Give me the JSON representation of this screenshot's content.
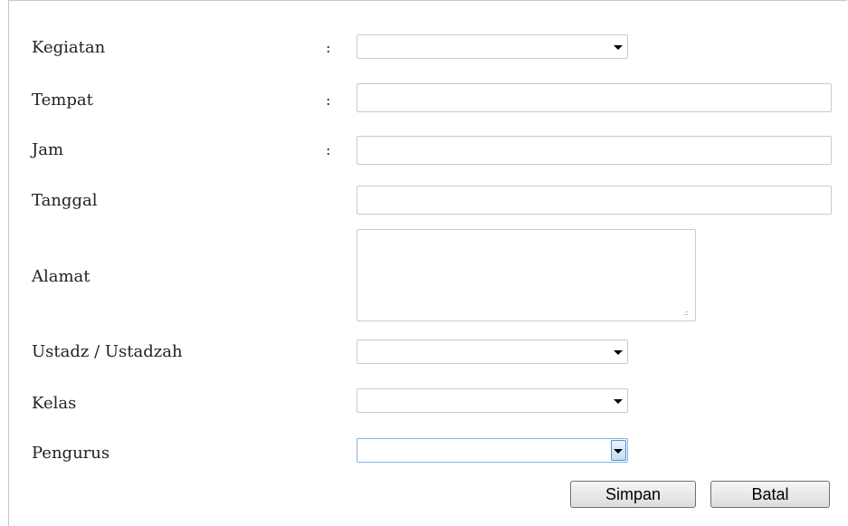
{
  "form": {
    "colon": ":",
    "kegiatan": {
      "label": "Kegiatan",
      "value": ""
    },
    "tempat": {
      "label": "Tempat",
      "value": ""
    },
    "jam": {
      "label": "Jam",
      "value": ""
    },
    "tanggal": {
      "label": "Tanggal",
      "value": ""
    },
    "alamat": {
      "label": "Alamat",
      "value": ""
    },
    "ustadz": {
      "label": "Ustadz / Ustadzah",
      "value": ""
    },
    "kelas": {
      "label": "Kelas",
      "value": ""
    },
    "pengurus": {
      "label": "Pengurus",
      "value": ""
    }
  },
  "buttons": {
    "simpan": "Simpan",
    "batal": "Batal"
  },
  "icons": {
    "dropdown": "caret-down-icon",
    "resize": "resize-grip-icon"
  }
}
